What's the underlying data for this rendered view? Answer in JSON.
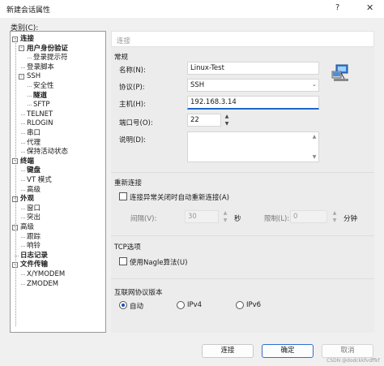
{
  "window": {
    "title": "新建会话属性",
    "help": "?",
    "close": "✕"
  },
  "category_label": "类别(C):",
  "tree": [
    {
      "label": "连接",
      "bold": true
    },
    {
      "label": "用户身份验证",
      "bold": true
    },
    {
      "label": "登录提示符",
      "bold": false
    },
    {
      "label": "登录脚本",
      "bold": false
    },
    {
      "label": "SSH",
      "bold": false
    },
    {
      "label": "安全性",
      "bold": false
    },
    {
      "label": "隧道",
      "bold": true
    },
    {
      "label": "SFTP",
      "bold": false
    },
    {
      "label": "TELNET",
      "bold": false
    },
    {
      "label": "RLOGIN",
      "bold": false
    },
    {
      "label": "串口",
      "bold": false
    },
    {
      "label": "代理",
      "bold": false
    },
    {
      "label": "保持活动状态",
      "bold": false
    },
    {
      "label": "终端",
      "bold": true
    },
    {
      "label": "键盘",
      "bold": true
    },
    {
      "label": "VT 模式",
      "bold": false
    },
    {
      "label": "高级",
      "bold": false
    },
    {
      "label": "外观",
      "bold": true
    },
    {
      "label": "窗口",
      "bold": false
    },
    {
      "label": "突出",
      "bold": false
    },
    {
      "label": "高级",
      "bold": false
    },
    {
      "label": "跟踪",
      "bold": false
    },
    {
      "label": "响铃",
      "bold": false
    },
    {
      "label": "日志记录",
      "bold": true
    },
    {
      "label": "文件传输",
      "bold": true
    },
    {
      "label": "X/YMODEM",
      "bold": false
    },
    {
      "label": "ZMODEM",
      "bold": false
    }
  ],
  "panel": {
    "header": "连接",
    "general": {
      "title": "常规",
      "name_label": "名称(N):",
      "name_value": "Linux-Test",
      "protocol_label": "协议(P):",
      "protocol_value": "SSH",
      "host_label": "主机(H):",
      "host_value": "192.168.3.14",
      "port_label": "端口号(O):",
      "port_value": "22",
      "desc_label": "说明(D):",
      "desc_value": ""
    },
    "reconnect": {
      "title": "重新连接",
      "auto_label": "连接异常关闭时自动重新连接(A)",
      "interval_label": "间隔(V):",
      "interval_value": "30",
      "interval_unit": "秒",
      "limit_label": "限制(L):",
      "limit_value": "0",
      "limit_unit": "分钟"
    },
    "tcp": {
      "title": "TCP选项",
      "nagle_label": "使用Nagle算法(U)"
    },
    "ip": {
      "title": "互联网协议版本",
      "auto": "自动",
      "ipv4": "IPv4",
      "ipv6": "IPv6",
      "selected": "自动"
    }
  },
  "buttons": {
    "connect": "连接",
    "ok": "确定",
    "cancel": "取消"
  },
  "watermark": "CSDN @dodckkfvdffkf",
  "icons": {
    "network": "network-computer-icon"
  }
}
